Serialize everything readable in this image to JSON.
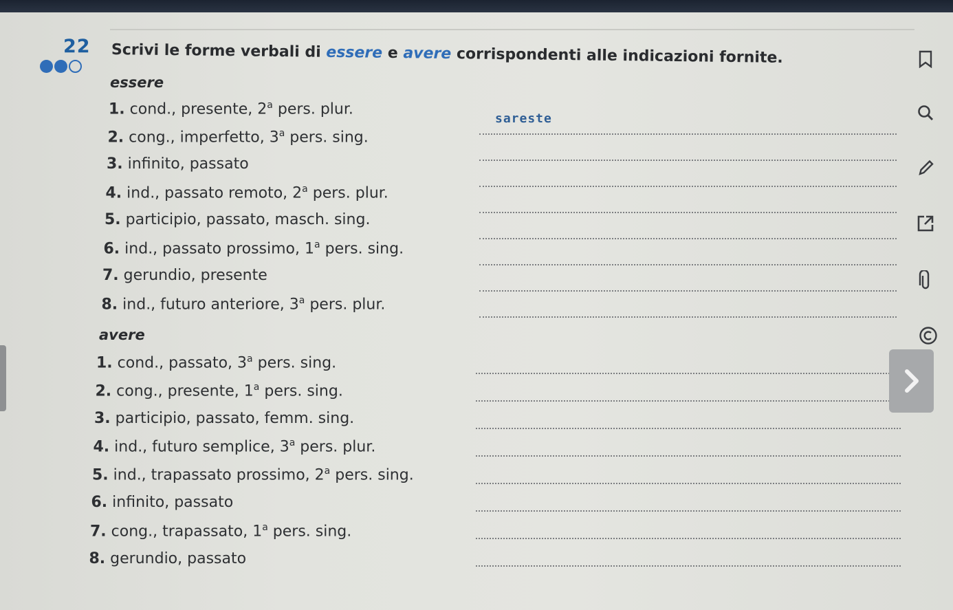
{
  "exercise": {
    "number": "22",
    "difficulty_filled": 2,
    "difficulty_total": 3,
    "instruction": {
      "part1": "Scrivi le forme verbali di ",
      "word1": "essere",
      "part2": " e ",
      "word2": "avere",
      "part3": " corrispondenti alle indicazioni fornite."
    }
  },
  "essere": {
    "title": "essere",
    "items": [
      {
        "num": "1.",
        "text1": "cond., presente, ",
        "sup_base": "2",
        "sup": "a",
        "text2": " pers. plur.",
        "answer": "sareste"
      },
      {
        "num": "2.",
        "text1": "cong., imperfetto, ",
        "sup_base": "3",
        "sup": "a",
        "text2": " pers. sing.",
        "answer": ""
      },
      {
        "num": "3.",
        "text1": "infinito, passato",
        "sup_base": "",
        "sup": "",
        "text2": "",
        "answer": ""
      },
      {
        "num": "4.",
        "text1": "ind., passato remoto, ",
        "sup_base": "2",
        "sup": "a",
        "text2": " pers. plur.",
        "answer": ""
      },
      {
        "num": "5.",
        "text1": "participio, passato, masch. sing.",
        "sup_base": "",
        "sup": "",
        "text2": "",
        "answer": ""
      },
      {
        "num": "6.",
        "text1": "ind., passato prossimo, ",
        "sup_base": "1",
        "sup": "a",
        "text2": " pers. sing.",
        "answer": ""
      },
      {
        "num": "7.",
        "text1": "gerundio, presente",
        "sup_base": "",
        "sup": "",
        "text2": "",
        "answer": ""
      },
      {
        "num": "8.",
        "text1": "ind., futuro anteriore, ",
        "sup_base": "3",
        "sup": "a",
        "text2": " pers. plur.",
        "answer": ""
      }
    ]
  },
  "avere": {
    "title": "avere",
    "items": [
      {
        "num": "1.",
        "text1": "cond., passato, ",
        "sup_base": "3",
        "sup": "a",
        "text2": " pers. sing."
      },
      {
        "num": "2.",
        "text1": "cong., presente, ",
        "sup_base": "1",
        "sup": "a",
        "text2": " pers. sing."
      },
      {
        "num": "3.",
        "text1": "participio, passato, femm. sing.",
        "sup_base": "",
        "sup": "",
        "text2": ""
      },
      {
        "num": "4.",
        "text1": "ind., futuro semplice, ",
        "sup_base": "3",
        "sup": "a",
        "text2": " pers. plur."
      },
      {
        "num": "5.",
        "text1": "ind., trapassato prossimo, ",
        "sup_base": "2",
        "sup": "a",
        "text2": " pers. sing."
      },
      {
        "num": "6.",
        "text1": "infinito, passato",
        "sup_base": "",
        "sup": "",
        "text2": ""
      },
      {
        "num": "7.",
        "text1": "cong., trapassato, ",
        "sup_base": "1",
        "sup": "a",
        "text2": " pers. sing."
      },
      {
        "num": "8.",
        "text1": "gerundio, passato",
        "sup_base": "",
        "sup": "",
        "text2": ""
      }
    ]
  },
  "toolbar": {
    "icons": [
      "bookmark-icon",
      "search-icon",
      "pencil-icon",
      "external-link-icon",
      "paperclip-icon",
      "copyright-icon"
    ],
    "next_icon": "chevron-right-icon"
  },
  "colors": {
    "accent": "#2f6db8",
    "text": "#2e3033",
    "background": "#e2e3de"
  }
}
